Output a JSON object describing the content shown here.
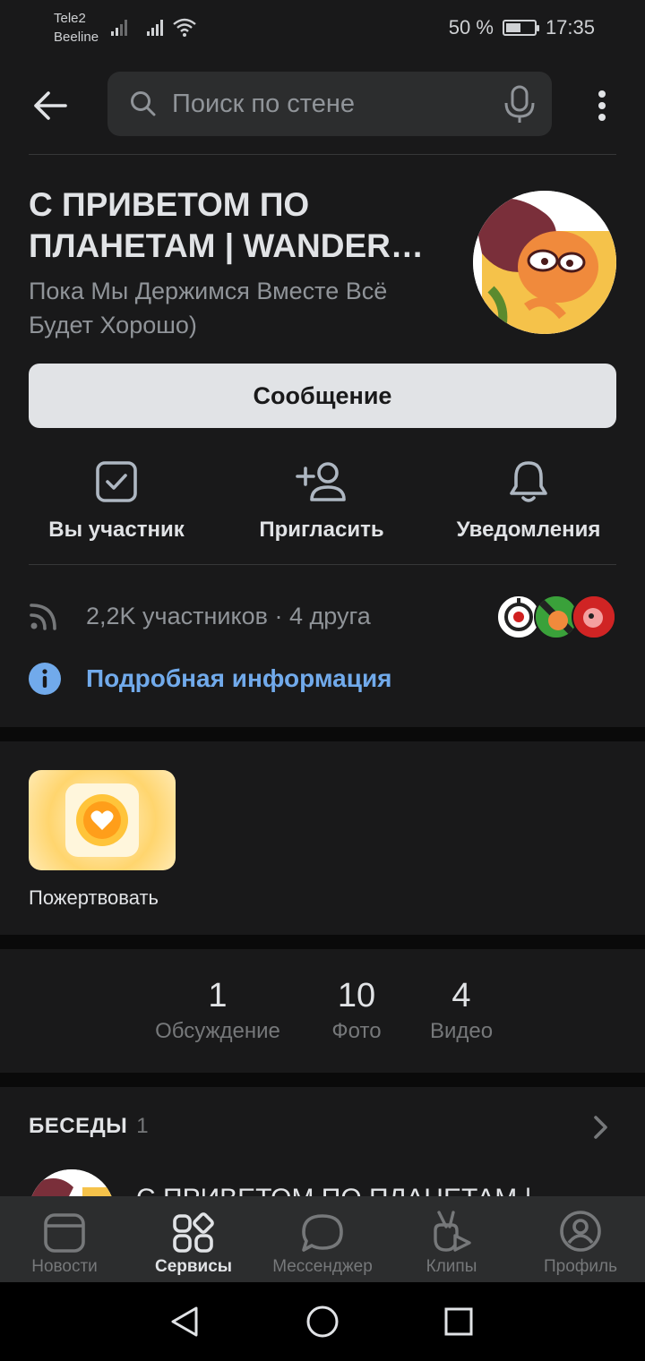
{
  "status_bar": {
    "carrier1": "Tele2",
    "carrier2": "Beeline",
    "battery": "50 %",
    "time": "17:35"
  },
  "header": {
    "search_placeholder": "Поиск по стене"
  },
  "group": {
    "name": "С ПРИВЕТОМ ПО ПЛАНЕТАМ | WANDER…",
    "status": "Пока Мы Держимся Вместе Всё Будет Хорошо)",
    "message_button": "Сообщение"
  },
  "actions": [
    {
      "label": "Вы участник",
      "icon": "checkbox-icon"
    },
    {
      "label": "Пригласить",
      "icon": "add-user-icon"
    },
    {
      "label": "Уведомления",
      "icon": "bell-icon"
    }
  ],
  "members": {
    "text": "2,2K участников · 4 друга"
  },
  "details_link": "Подробная информация",
  "donate": {
    "label": "Пожертвовать"
  },
  "counters": [
    {
      "value": "1",
      "caption": "Обсуждение"
    },
    {
      "value": "10",
      "caption": "Фото"
    },
    {
      "value": "4",
      "caption": "Видео"
    }
  ],
  "chats": {
    "title": "БЕСЕДЫ",
    "count": "1",
    "item_title": "С ПРИВЕТОМ ПО ПЛАНЕТАМ |"
  },
  "bottom_nav": [
    {
      "label": "Новости",
      "icon": "news-icon",
      "active": false
    },
    {
      "label": "Сервисы",
      "icon": "services-icon",
      "active": true
    },
    {
      "label": "Мессенджер",
      "icon": "messenger-icon",
      "active": false
    },
    {
      "label": "Клипы",
      "icon": "clips-icon",
      "active": false
    },
    {
      "label": "Профиль",
      "icon": "profile-icon",
      "active": false
    }
  ],
  "colors": {
    "background": "#19191a",
    "accent_link": "#71aaeb",
    "info_icon": "#71aaeb",
    "button_bg": "#e1e3e6",
    "nav_bg": "#2c2d2e"
  }
}
